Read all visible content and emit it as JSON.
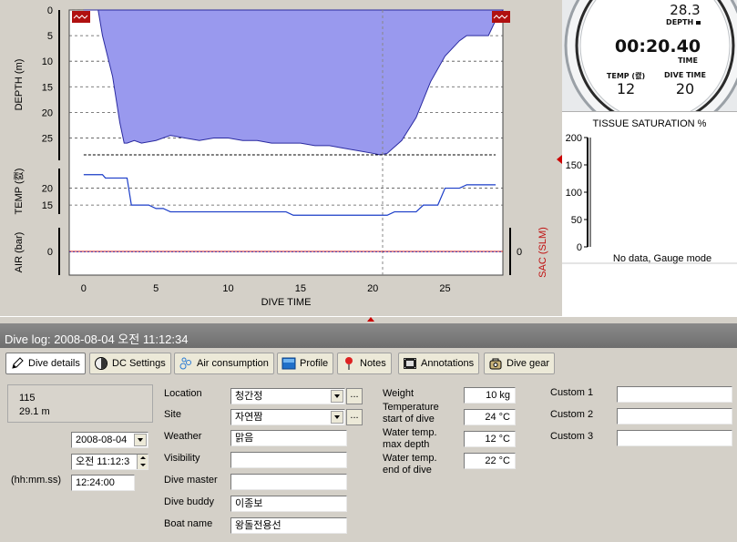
{
  "chart_data": {
    "type": "area",
    "xlabel": "DIVE TIME",
    "x_ticks": [
      0,
      5,
      10,
      15,
      20,
      25
    ],
    "xlim": [
      -1,
      29
    ],
    "depth": {
      "ylabel": "DEPTH (m)",
      "y_ticks": [
        0,
        5,
        10,
        15,
        20,
        25
      ],
      "ylim": [
        0,
        28.3
      ],
      "inverted": true,
      "max_depth_line": 28.3,
      "x": [
        0,
        1,
        1.3,
        2,
        2.5,
        2.8,
        3,
        3.5,
        4,
        5,
        6,
        7,
        8,
        9,
        10,
        11,
        12,
        13,
        14,
        15,
        16,
        17,
        18,
        19,
        20,
        20.5,
        21,
        22,
        23,
        24,
        25,
        26,
        26.5,
        27,
        28,
        28.5,
        29
      ],
      "y": [
        0,
        0,
        5,
        13,
        22,
        26,
        26,
        25.5,
        26,
        25.5,
        24.5,
        25,
        25.5,
        25,
        25,
        25.5,
        25.5,
        26,
        26,
        26,
        26.5,
        26.5,
        27,
        27.5,
        28,
        28.3,
        28,
        25.5,
        21,
        14,
        9,
        6,
        5,
        5,
        5,
        2,
        0
      ]
    },
    "temp": {
      "ylabel": "TEMP (캜)",
      "y_ticks": [
        15,
        20
      ],
      "ylim": [
        11,
        25
      ],
      "x": [
        0,
        1.3,
        1.5,
        3,
        3.3,
        4.5,
        5,
        5.5,
        6,
        10,
        14,
        14.5,
        20,
        21,
        21.5,
        23,
        23.5,
        24.5,
        25,
        26,
        26.5,
        28.5
      ],
      "y": [
        24,
        24,
        23,
        23,
        15,
        15,
        14,
        14,
        13,
        13,
        13,
        12,
        12,
        12,
        13,
        13,
        15,
        15,
        20,
        20,
        21,
        21
      ]
    },
    "air": {
      "ylabel": "AIR (bar)",
      "y_ticks": [
        0
      ],
      "right_label": "SAC (SLM)",
      "right_ticks": [
        0
      ],
      "values": [
        0
      ]
    }
  },
  "gauge": {
    "depth_value": "28.3",
    "depth_label": "DEPTH ",
    "time_value": "00:20.40",
    "time_label": "TIME",
    "temp_label": "TEMP (캜)",
    "temp_value": "12",
    "dive_time_label": "DIVE TIME",
    "dive_time_value": "20"
  },
  "tissue": {
    "title": "TISSUE SATURATION %",
    "ticks": [
      "200",
      "150",
      "100",
      "50",
      "0"
    ],
    "no_data": "No data, Gauge mode"
  },
  "dive_log": {
    "header": "Dive log: 2008-08-04 오전 11:12:34"
  },
  "tabs": [
    {
      "label": "Dive details",
      "icon": "pencil-icon",
      "active": true
    },
    {
      "label": "DC Settings",
      "icon": "dive-computer-icon",
      "active": false
    },
    {
      "label": "Air consumption",
      "icon": "bubbles-icon",
      "active": false
    },
    {
      "label": "Profile",
      "icon": "profile-icon",
      "active": false
    },
    {
      "label": "Notes",
      "icon": "pin-icon",
      "active": false
    },
    {
      "label": "Annotations",
      "icon": "film-icon",
      "active": false
    },
    {
      "label": "Dive gear",
      "icon": "gear-bag-icon",
      "active": false
    }
  ],
  "details": {
    "dive_number": "115",
    "max_depth": "29.1 m",
    "date": "2008-08-04",
    "time": "오전 11:12:3",
    "duration_label": "(hh:mm.ss)",
    "duration": "12:24:00",
    "location_label": "Location",
    "location": "청간정",
    "site_label": "Site",
    "site": "자연짬",
    "weather_label": "Weather",
    "weather": "맑음",
    "visibility_label": "Visibility",
    "visibility": "",
    "dive_master_label": "Dive master",
    "dive_master": "",
    "dive_buddy_label": "Dive buddy",
    "dive_buddy": "이종보",
    "boat_name_label": "Boat name",
    "boat_name": "왕돌전용선",
    "more_button": "...",
    "weight_label": "Weight",
    "weight": "10 kg",
    "temp_start_label_1": "Temperature",
    "temp_start_label_2": "start of dive",
    "temp_start": "24 °C",
    "temp_max_label_1": "Water temp.",
    "temp_max_label_2": "max depth",
    "temp_max": "12 °C",
    "temp_end_label_1": "Water temp.",
    "temp_end_label_2": "end of dive",
    "temp_end": "22 °C",
    "custom1_label": "Custom 1",
    "custom1": "",
    "custom2_label": "Custom 2",
    "custom2": "",
    "custom3_label": "Custom 3",
    "custom3": ""
  },
  "colors": {
    "depth_fill": "#9999ee",
    "temp_line": "#1a3cc8",
    "marker_red": "#b01010"
  }
}
